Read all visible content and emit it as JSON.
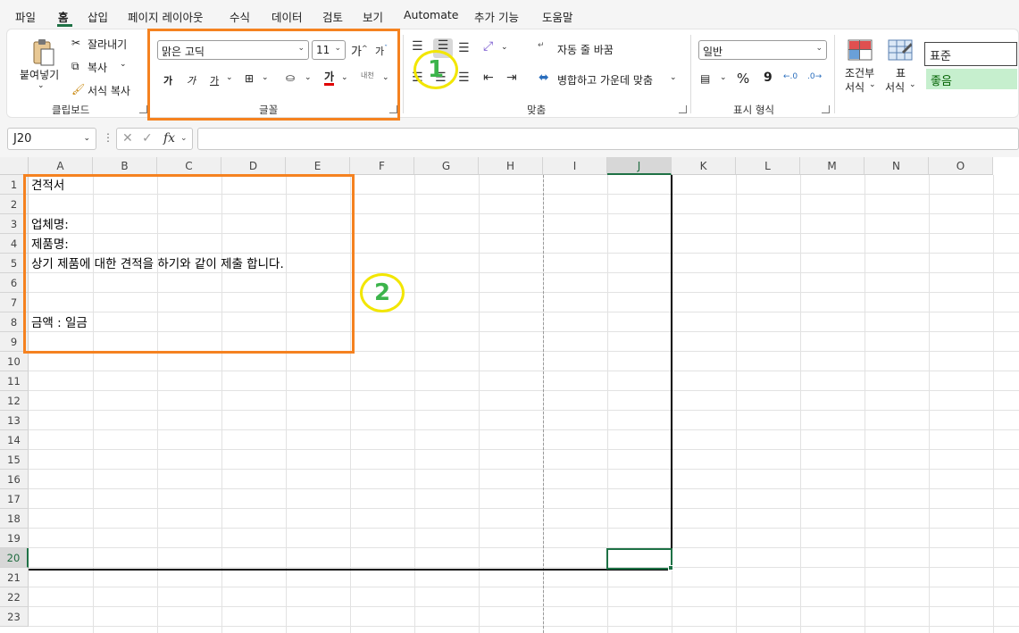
{
  "menu": {
    "items": [
      "파일",
      "홈",
      "삽입",
      "페이지 레이아웃",
      "수식",
      "데이터",
      "검토",
      "보기",
      "Automate",
      "추가 기능",
      "도움말"
    ],
    "active_index": 1
  },
  "ribbon": {
    "clipboard": {
      "paste_label": "붙여넣기",
      "cut_label": "잘라내기",
      "copy_label": "복사",
      "format_painter_label": "서식 복사",
      "group_label": "클립보드"
    },
    "font": {
      "font_name": "맑은 고딕",
      "font_size": "11",
      "grow_label": "가",
      "shrink_label": "가",
      "bold_label": "가",
      "italic_label": "가",
      "underline_label": "가",
      "font_color_label": "가",
      "phonetic_label": "내천",
      "group_label": "글꼴",
      "font_color": "#e00000"
    },
    "alignment": {
      "wrap_text_label": "자동 줄 바꿈",
      "merge_center_label": "병합하고 가운데 맞춤",
      "group_label": "맞춤"
    },
    "number": {
      "format_value": "일반",
      "percent_label": "%",
      "comma_label": "9",
      "group_label": "표시 형식"
    },
    "styles": {
      "conditional_label_1": "조건부",
      "conditional_label_2": "서식",
      "table_label_1": "표",
      "table_label_2": "서식",
      "style_normal": "표준",
      "style_good": "좋음",
      "good_color": "#c6efce"
    }
  },
  "formula_bar": {
    "name_box": "J20",
    "fx_label": "fx",
    "formula_value": ""
  },
  "sheet": {
    "columns": [
      "A",
      "B",
      "C",
      "D",
      "E",
      "F",
      "G",
      "H",
      "I",
      "J",
      "K",
      "L",
      "M",
      "N",
      "O"
    ],
    "rows": [
      "1",
      "2",
      "3",
      "4",
      "5",
      "6",
      "7",
      "8",
      "9",
      "10",
      "11",
      "12",
      "13",
      "14",
      "15",
      "16",
      "17",
      "18",
      "19",
      "20",
      "21",
      "22",
      "23"
    ],
    "selected_column": "J",
    "selected_row": "20",
    "cells": {
      "A1": "견적서",
      "A3": "업체명:",
      "A4": "제품명:",
      "A5": "상기 제품에 대한 견적을 하기와 같이 제출 합니다.",
      "A8": "금액 : 일금"
    }
  },
  "annotations": {
    "label_1": "1",
    "label_2": "2",
    "box_color": "#f58220",
    "circle_color": "#f2e600",
    "number_color": "#3cb44b"
  }
}
